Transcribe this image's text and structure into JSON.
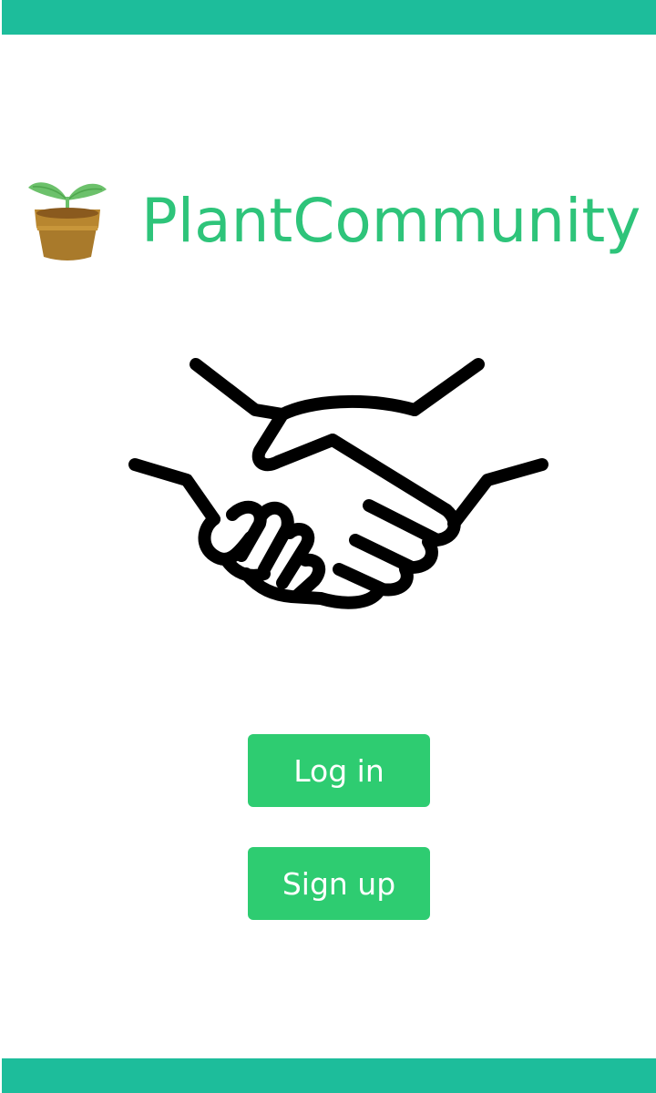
{
  "app": {
    "title": "PlantCommunity",
    "logo_icon": "potted-sprout-icon",
    "hero_icon": "handshake-icon"
  },
  "actions": {
    "login_label": "Log in",
    "signup_label": "Sign up"
  },
  "colors": {
    "bar": "#1dbd9b",
    "title": "#2ec47a",
    "button": "#2ecc71",
    "button_text": "#ffffff"
  }
}
